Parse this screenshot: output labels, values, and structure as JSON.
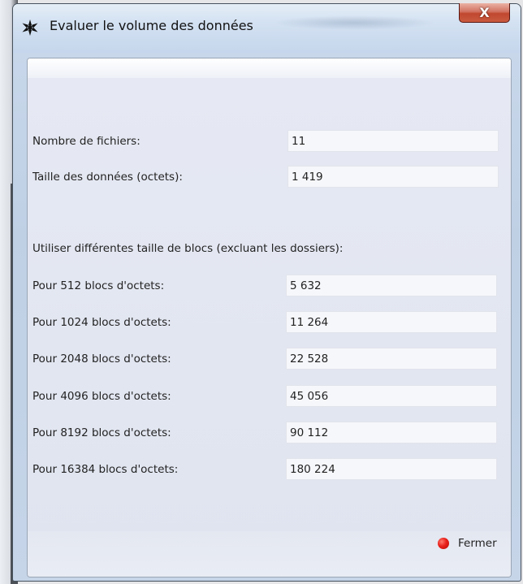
{
  "window": {
    "title": "Evaluer le volume des données",
    "close_glyph": "X",
    "icon": "black-snowflake-icon"
  },
  "summary": {
    "files_label": "Nombre de fichiers:",
    "files_value": "11",
    "size_label": "Taille des données (octets):",
    "size_value": "1 419"
  },
  "blocks": {
    "heading": "Utiliser différentes taille de blocs (excluant les dossiers):",
    "rows": [
      {
        "label": "Pour 512 blocs d'octets:",
        "value": "5 632"
      },
      {
        "label": "Pour 1024 blocs d'octets:",
        "value": "11 264"
      },
      {
        "label": "Pour 2048 blocs d'octets:",
        "value": "22 528"
      },
      {
        "label": "Pour 4096 blocs d'octets:",
        "value": "45 056"
      },
      {
        "label": "Pour 8192 blocs d'octets:",
        "value": "90 112"
      },
      {
        "label": "Pour 16384 blocs d'octets:",
        "value": "180 224"
      }
    ]
  },
  "footer": {
    "close_label": "Fermer",
    "close_icon_color": "#e8201a"
  }
}
